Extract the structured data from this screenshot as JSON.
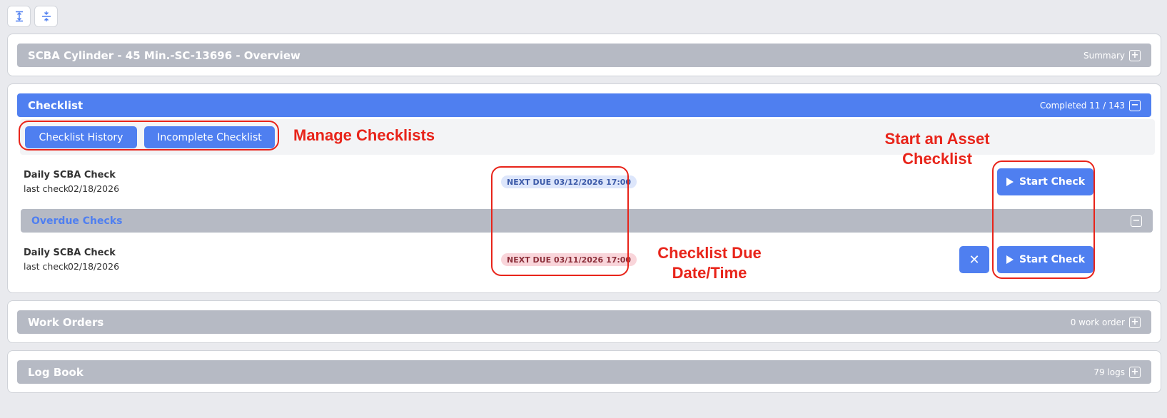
{
  "toolbar": {
    "expand_icon": "expand-all-icon",
    "collapse_icon": "collapse-all-icon"
  },
  "overview": {
    "title": "SCBA Cylinder - 45 Min.-SC-13696 - Overview",
    "right_label": "Summary",
    "toggle_symbol": "+"
  },
  "checklist": {
    "title": "Checklist",
    "right_label": "Completed 11 / 143",
    "toggle_symbol": "−",
    "history_button": "Checklist History",
    "incomplete_button": "Incomplete Checklist",
    "items": [
      {
        "name": "Daily SCBA Check",
        "last_check_label": "last check",
        "last_check_date": "02/18/2026",
        "next_due": "NEXT DUE 03/12/2026 17:00",
        "button": "Start Check"
      }
    ],
    "overdue": {
      "title": "Overdue Checks",
      "toggle_symbol": "−",
      "items": [
        {
          "name": "Daily SCBA Check",
          "last_check_label": "last check",
          "last_check_date": "02/18/2026",
          "next_due": "NEXT DUE 03/11/2026 17:00",
          "dismiss_symbol": "✕",
          "button": "Start Check"
        }
      ]
    }
  },
  "work_orders": {
    "title": "Work Orders",
    "right_label": "0 work order",
    "toggle_symbol": "+"
  },
  "log_book": {
    "title": "Log Book",
    "right_label": "79 logs",
    "toggle_symbol": "+"
  },
  "annotations": {
    "manage": "Manage Checklists",
    "start_line1": "Start an Asset",
    "start_line2": "Checklist",
    "due_line1": "Checklist Due",
    "due_line2": "Date/Time",
    "color": "#e8241a"
  },
  "colors": {
    "accent": "#4f7ff0",
    "bar_gray": "#b6bac4"
  }
}
